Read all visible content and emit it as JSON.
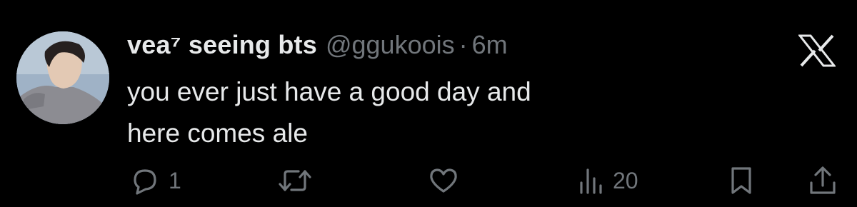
{
  "tweet": {
    "display_name": "vea⁷ seeing bts",
    "handle": "@ggukoois",
    "separator": "·",
    "time": "6m",
    "text_lines": [
      "you ever just have a good day and",
      "here comes ale"
    ]
  },
  "actions": {
    "reply_count": "1",
    "views_count": "20"
  },
  "icons": {
    "avatar": "profile-photo",
    "brand": "x-logo",
    "reply": "speech-bubble-icon",
    "retweet": "repost-arrows-icon",
    "like": "heart-icon",
    "views": "bar-chart-icon",
    "bookmark": "bookmark-icon",
    "share": "share-upload-icon"
  },
  "colors": {
    "background": "#000000",
    "primary_text": "#e7e9ea",
    "secondary_text": "#71767b"
  }
}
